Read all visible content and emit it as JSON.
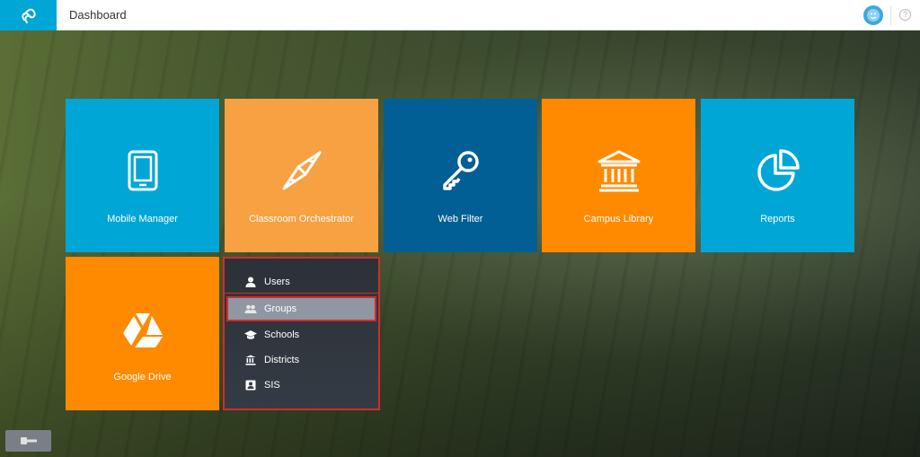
{
  "header": {
    "title": "Dashboard",
    "logo_icon": "infinity-logo-icon",
    "avatar_icon": "smiley-avatar-icon",
    "help_label": "?"
  },
  "tiles": [
    {
      "label": "Mobile Manager",
      "icon": "tablet-icon",
      "color": "#00a6d6"
    },
    {
      "label": "Classroom Orchestrator",
      "icon": "compass-arrows-icon",
      "color": "#f7a143"
    },
    {
      "label": "Web Filter",
      "icon": "key-icon",
      "color": "#015f96"
    },
    {
      "label": "Campus Library",
      "icon": "library-building-icon",
      "color": "#ff8a00"
    },
    {
      "label": "Reports",
      "icon": "pie-chart-icon",
      "color": "#00a6d6"
    },
    {
      "label": "Google Drive",
      "icon": "google-drive-icon",
      "color": "#ff8a00"
    }
  ],
  "menu": {
    "items": [
      {
        "label": "Users",
        "icon": "user-icon"
      },
      {
        "label": "Groups",
        "icon": "group-icon",
        "selected": true
      },
      {
        "label": "Schools",
        "icon": "graduation-cap-icon"
      },
      {
        "label": "Districts",
        "icon": "building-columns-icon"
      },
      {
        "label": "SIS",
        "icon": "contact-card-icon"
      }
    ]
  },
  "sidebar_toggle": {
    "icon": "key-tab-icon"
  }
}
